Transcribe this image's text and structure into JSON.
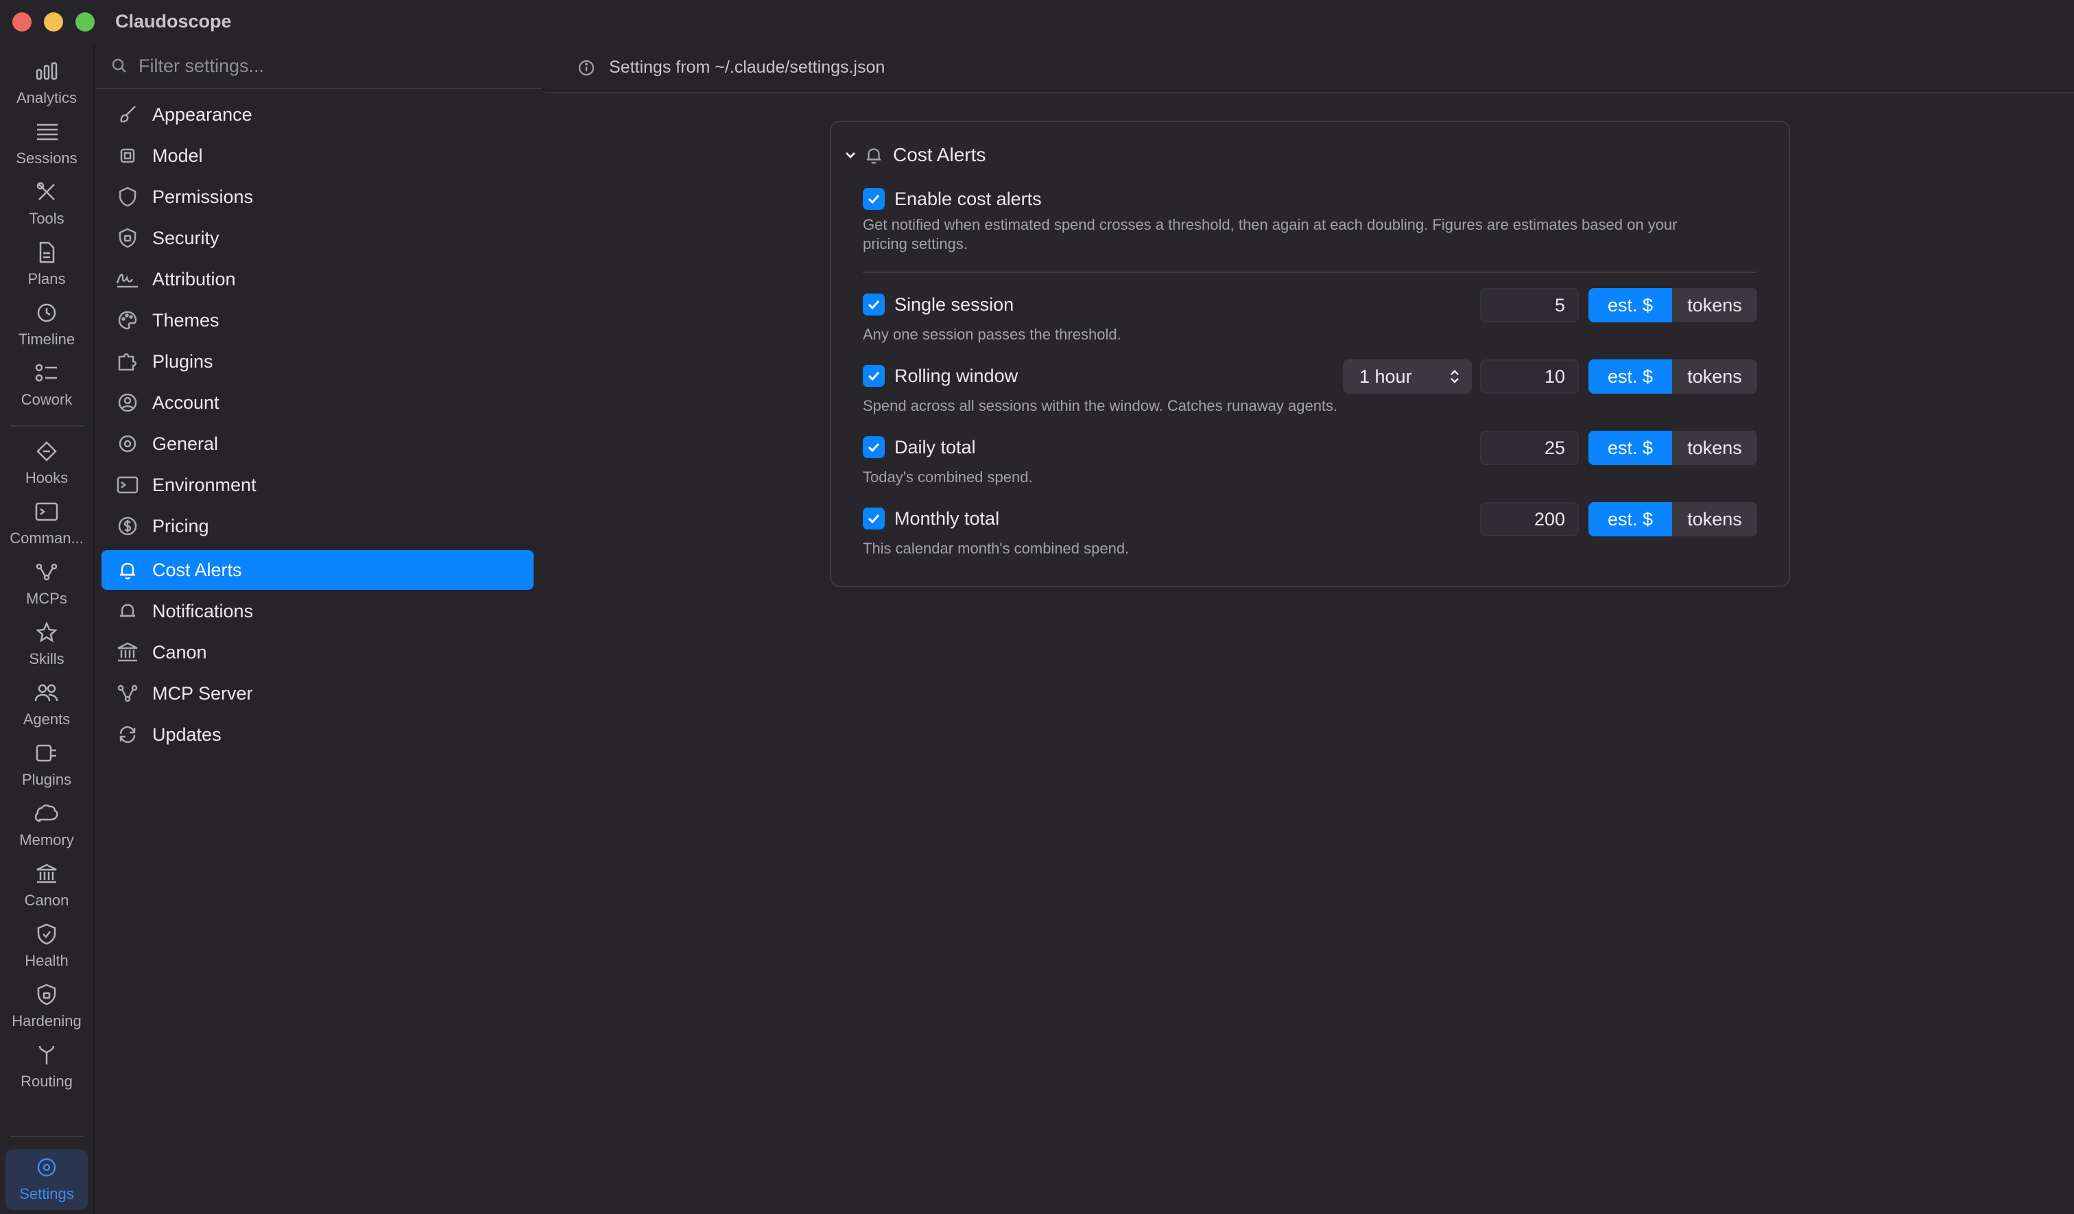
{
  "app": {
    "title": "Claudoscope"
  },
  "rail": {
    "items": [
      {
        "label": "Analytics",
        "icon": "bar-chart-icon"
      },
      {
        "label": "Sessions",
        "icon": "list-icon"
      },
      {
        "label": "Tools",
        "icon": "tools-icon"
      },
      {
        "label": "Plans",
        "icon": "document-icon"
      },
      {
        "label": "Timeline",
        "icon": "history-icon"
      },
      {
        "label": "Cowork",
        "icon": "checklist-icon"
      },
      {
        "label": "Hooks",
        "icon": "hook-diamond-icon"
      },
      {
        "label": "Comman...",
        "icon": "terminal-icon"
      },
      {
        "label": "MCPs",
        "icon": "network-icon"
      },
      {
        "label": "Skills",
        "icon": "star-icon"
      },
      {
        "label": "Agents",
        "icon": "people-icon"
      },
      {
        "label": "Plugins",
        "icon": "plug-icon"
      },
      {
        "label": "Memory",
        "icon": "brain-icon"
      },
      {
        "label": "Canon",
        "icon": "bank-icon"
      },
      {
        "label": "Health",
        "icon": "shield-check-icon"
      },
      {
        "label": "Hardening",
        "icon": "shield-lock-icon"
      },
      {
        "label": "Routing",
        "icon": "fork-icon"
      }
    ],
    "settings": {
      "label": "Settings",
      "icon": "gear-icon"
    }
  },
  "search": {
    "placeholder": "Filter settings..."
  },
  "nav": {
    "items": [
      {
        "label": "Appearance",
        "icon": "paintbrush-icon"
      },
      {
        "label": "Model",
        "icon": "cpu-icon"
      },
      {
        "label": "Permissions",
        "icon": "shield-icon"
      },
      {
        "label": "Security",
        "icon": "shield-lock-icon"
      },
      {
        "label": "Attribution",
        "icon": "signature-icon"
      },
      {
        "label": "Themes",
        "icon": "palette-icon"
      },
      {
        "label": "Plugins",
        "icon": "puzzle-icon"
      },
      {
        "label": "Account",
        "icon": "person-circle-icon"
      },
      {
        "label": "General",
        "icon": "gear-icon"
      },
      {
        "label": "Environment",
        "icon": "terminal-icon"
      },
      {
        "label": "Pricing",
        "icon": "dollar-circle-icon"
      },
      {
        "label": "Cost Alerts",
        "icon": "bell-alert-icon"
      },
      {
        "label": "Notifications",
        "icon": "bell-icon"
      },
      {
        "label": "Canon",
        "icon": "bank-icon"
      },
      {
        "label": "MCP Server",
        "icon": "network-icon"
      },
      {
        "label": "Updates",
        "icon": "refresh-icon"
      }
    ],
    "selected": "Cost Alerts"
  },
  "header": {
    "text": "Settings from ~/.claude/settings.json"
  },
  "card": {
    "title": "Cost Alerts",
    "enable": {
      "label": "Enable cost alerts",
      "checked": true,
      "desc_line1": "Get notified when estimated spend crosses a threshold, then again at each doubling. Figures are estimates based on your",
      "desc_line2": "pricing settings."
    },
    "rows": [
      {
        "label": "Single session",
        "checked": true,
        "value": "5",
        "unit_a": "est. $",
        "unit_b": "tokens",
        "desc": "Any one session passes the threshold."
      },
      {
        "label": "Rolling window",
        "checked": true,
        "window": "1 hour",
        "value": "10",
        "unit_a": "est. $",
        "unit_b": "tokens",
        "desc": "Spend across all sessions within the window. Catches runaway agents."
      },
      {
        "label": "Daily total",
        "checked": true,
        "value": "25",
        "unit_a": "est. $",
        "unit_b": "tokens",
        "desc": "Today's combined spend."
      },
      {
        "label": "Monthly total",
        "checked": true,
        "value": "200",
        "unit_a": "est. $",
        "unit_b": "tokens",
        "desc": "This calendar month's combined spend."
      }
    ]
  },
  "colors": {
    "accent": "#0a84ff",
    "background": "#262429"
  }
}
